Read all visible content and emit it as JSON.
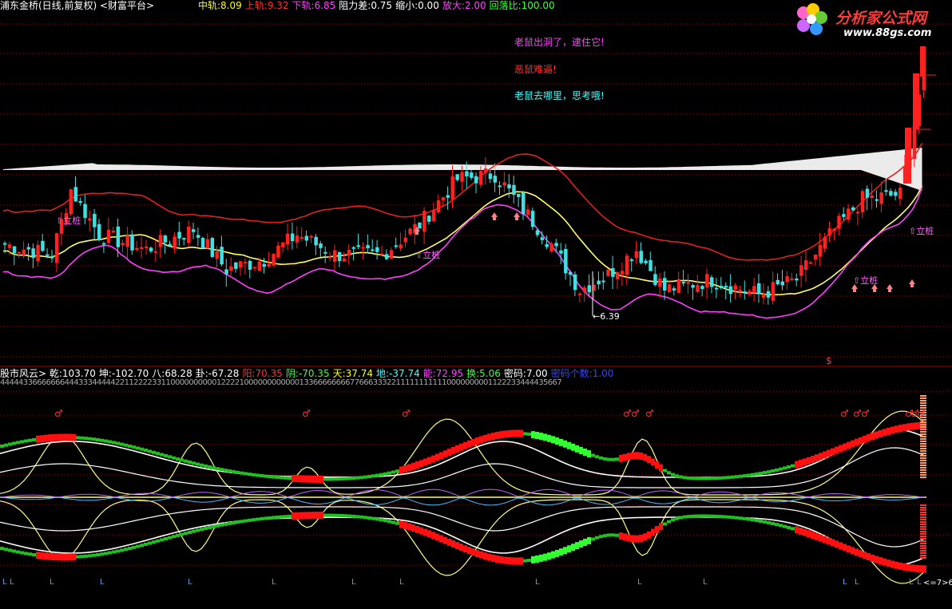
{
  "top_header": {
    "title": "浦东金桥(日线,前复权) <财富平台>",
    "items": [
      {
        "label": "中轨:",
        "value": "8.09",
        "color": "#ffff00"
      },
      {
        "label": "上轨:",
        "value": "9.32",
        "color": "#ff3030"
      },
      {
        "label": "下轨:",
        "value": "6.85",
        "color": "#ff40ff"
      },
      {
        "label": "阻力差:",
        "value": "0.75",
        "color": "#ffffff"
      },
      {
        "label": "缩小:",
        "value": "0.00",
        "color": "#ffffff"
      },
      {
        "label": "放大:",
        "value": "2.00",
        "color": "#ff40ff"
      },
      {
        "label": "回落比:",
        "value": "100.00",
        "color": "#40ff40"
      }
    ]
  },
  "logo": {
    "text": "分析家公式网",
    "url": "www.88gs.com"
  },
  "notes": [
    {
      "text": "老鼠出洞了，逮住它!",
      "color": "#ff40ff"
    },
    {
      "text": "恶鼠难逼!",
      "color": "#ff3030"
    },
    {
      "text": "老鼠去哪里，思考哦!",
      "color": "#40ffff"
    }
  ],
  "price_annotations": {
    "low_label": "6.39",
    "buy_label": "立桩",
    "dollar": "$"
  },
  "bottom_header": {
    "title": "股市风云>",
    "items": [
      {
        "label": "乾:",
        "value": "103.70",
        "color": "#ffffff"
      },
      {
        "label": "坤:",
        "value": "-102.70",
        "color": "#ffffff"
      },
      {
        "label": "八:",
        "value": "68.28",
        "color": "#ffffff"
      },
      {
        "label": "卦:",
        "value": "-67.28",
        "color": "#ffffff"
      },
      {
        "label": "阳:",
        "value": "70.35",
        "color": "#ff3030"
      },
      {
        "label": "阴:",
        "value": "-70.35",
        "color": "#40ff40"
      },
      {
        "label": "天:",
        "value": "37.74",
        "color": "#ffff00"
      },
      {
        "label": "地:",
        "value": "-37.74",
        "color": "#40ffff"
      },
      {
        "label": "能:",
        "value": "72.95",
        "color": "#ff40ff"
      },
      {
        "label": "换:",
        "value": "5.06",
        "color": "#40ff40"
      },
      {
        "label": "密码:",
        "value": "7.00",
        "color": "#ffffff"
      },
      {
        "label": "密码个数:",
        "value": "1.00",
        "color": "#4040ff"
      }
    ]
  },
  "digit_row": "44444336666666444333444442211222233110000000000122221000000000000133666666667766633322111111111110000000001122233444435667",
  "bottom_marks": {
    "symbol": "♂",
    "letter": "L",
    "end_label": "<=7>6"
  },
  "colors": {
    "up": "#ff2020",
    "down": "#40e0e0",
    "mid": "#ffff66",
    "upper": "#e02020",
    "lower": "#ff40ff",
    "white_band": "#ffffff",
    "grid": "#8b0000"
  }
}
